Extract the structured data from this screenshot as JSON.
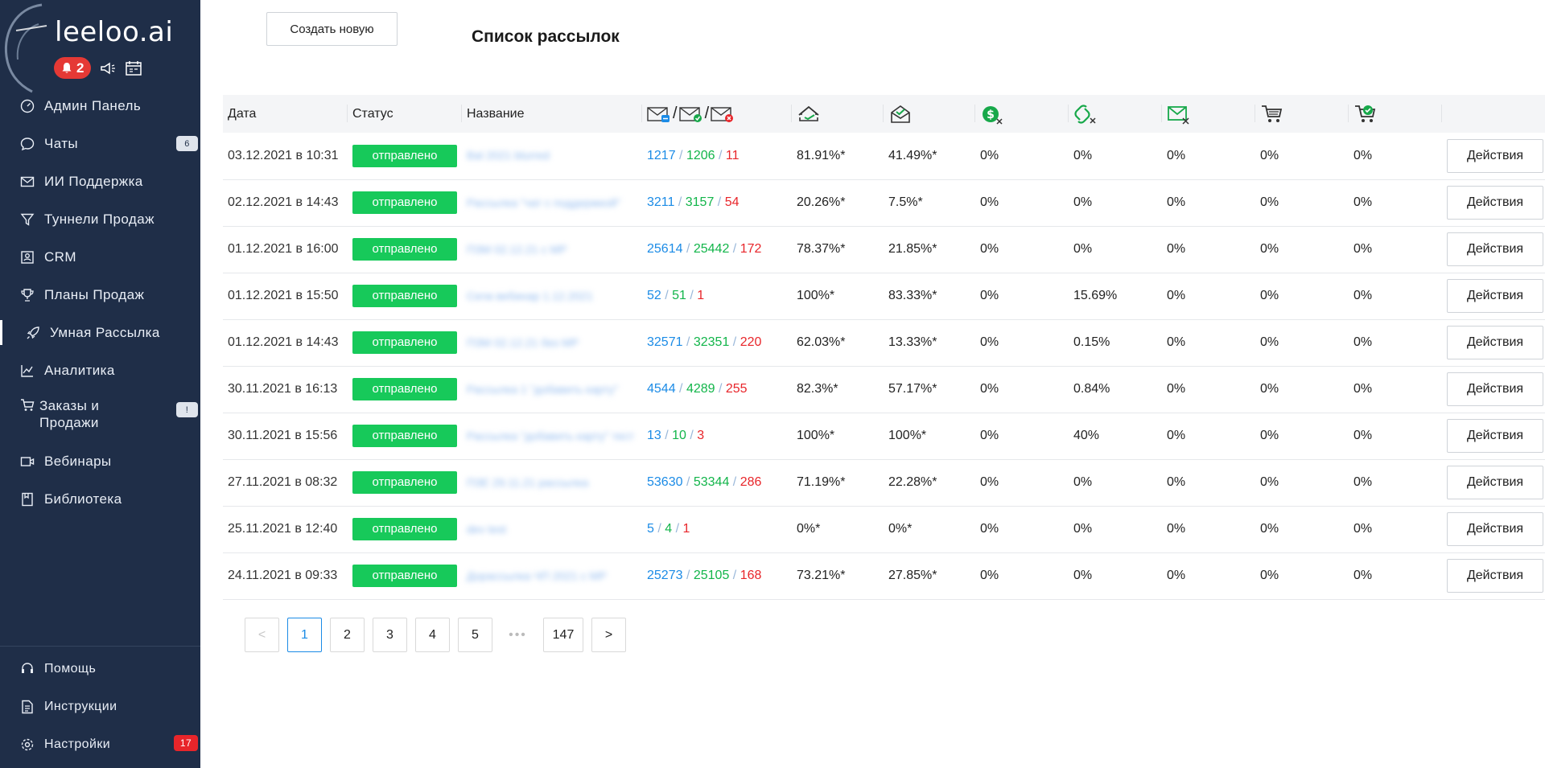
{
  "sidebar": {
    "brand": "leeloo.ai",
    "notifications_count": "2",
    "items": [
      {
        "label": "Админ Панель",
        "icon": "dashboard-icon"
      },
      {
        "label": "Чаты",
        "icon": "chat-icon",
        "badge": "6"
      },
      {
        "label": "ИИ Поддержка",
        "icon": "mail-icon"
      },
      {
        "label": "Туннели Продаж",
        "icon": "funnel-icon"
      },
      {
        "label": "CRM",
        "icon": "crm-icon"
      },
      {
        "label": "Планы Продаж",
        "icon": "trophy-icon"
      },
      {
        "label": "Умная Рассылка",
        "icon": "rocket-icon",
        "active": true
      },
      {
        "label": "Аналитика",
        "icon": "chart-icon"
      },
      {
        "label": "Заказы и\nПродажи",
        "icon": "cart-icon",
        "badge": "!"
      },
      {
        "label": "Вебинары",
        "icon": "video-icon"
      },
      {
        "label": "Библиотека",
        "icon": "book-icon"
      }
    ],
    "bottom_items": [
      {
        "label": "Помощь",
        "icon": "headset-icon"
      },
      {
        "label": "Инструкции",
        "icon": "document-icon"
      },
      {
        "label": "Настройки",
        "icon": "settings-icon",
        "badge": "17"
      }
    ]
  },
  "main": {
    "create_button": "Создать новую",
    "title": "Список рассылок",
    "columns": [
      "Дата",
      "Статус",
      "Название",
      "sent-delivered-failed-icon",
      "opened-icon",
      "read-icon",
      "paid-icon",
      "link-clicks-icon",
      "unsubscribed-icon",
      "cart-icon",
      "cart-purchased-icon"
    ],
    "rows": [
      {
        "date": "03.12.2021 в 10:31",
        "status": "отправлено",
        "name": "Bal 2021 blurred",
        "sent": "1217",
        "delivered": "1206",
        "failed": "11",
        "m1": "81.91%*",
        "m2": "41.49%*",
        "m3": "0%",
        "m4": "0%",
        "m5": "0%",
        "m6": "0%",
        "m7": "0%",
        "action": "Действия"
      },
      {
        "date": "02.12.2021 в 14:43",
        "status": "отправлено",
        "name": "Рассылка \"чат с поддержкой\"",
        "sent": "3211",
        "delivered": "3157",
        "failed": "54",
        "m1": "20.26%*",
        "m2": "7.5%*",
        "m3": "0%",
        "m4": "0%",
        "m5": "0%",
        "m6": "0%",
        "m7": "0%",
        "action": "Действия"
      },
      {
        "date": "01.12.2021 в 16:00",
        "status": "отправлено",
        "name": "ПЗМ 02.12.21 с МР",
        "sent": "25614",
        "delivered": "25442",
        "failed": "172",
        "m1": "78.37%*",
        "m2": "21.85%*",
        "m3": "0%",
        "m4": "0%",
        "m5": "0%",
        "m6": "0%",
        "m7": "0%",
        "action": "Действия"
      },
      {
        "date": "01.12.2021 в 15:50",
        "status": "отправлено",
        "name": "Сегм вебинар 1.12.2021",
        "sent": "52",
        "delivered": "51",
        "failed": "1",
        "m1": "100%*",
        "m2": "83.33%*",
        "m3": "0%",
        "m4": "15.69%",
        "m5": "0%",
        "m6": "0%",
        "m7": "0%",
        "action": "Действия"
      },
      {
        "date": "01.12.2021 в 14:43",
        "status": "отправлено",
        "name": "ПЗМ 02.12.21 без МР",
        "sent": "32571",
        "delivered": "32351",
        "failed": "220",
        "m1": "62.03%*",
        "m2": "13.33%*",
        "m3": "0%",
        "m4": "0.15%",
        "m5": "0%",
        "m6": "0%",
        "m7": "0%",
        "action": "Действия"
      },
      {
        "date": "30.11.2021 в 16:13",
        "status": "отправлено",
        "name": "Рассылка 1 \"добавить карту\"",
        "sent": "4544",
        "delivered": "4289",
        "failed": "255",
        "m1": "82.3%*",
        "m2": "57.17%*",
        "m3": "0%",
        "m4": "0.84%",
        "m5": "0%",
        "m6": "0%",
        "m7": "0%",
        "action": "Действия"
      },
      {
        "date": "30.11.2021 в 15:56",
        "status": "отправлено",
        "name": "Рассылка \"добавить карту\" тест",
        "sent": "13",
        "delivered": "10",
        "failed": "3",
        "m1": "100%*",
        "m2": "100%*",
        "m3": "0%",
        "m4": "40%",
        "m5": "0%",
        "m6": "0%",
        "m7": "0%",
        "action": "Действия"
      },
      {
        "date": "27.11.2021 в 08:32",
        "status": "отправлено",
        "name": "ПЗЕ 29.11.21 рассылка",
        "sent": "53630",
        "delivered": "53344",
        "failed": "286",
        "m1": "71.19%*",
        "m2": "22.28%*",
        "m3": "0%",
        "m4": "0%",
        "m5": "0%",
        "m6": "0%",
        "m7": "0%",
        "action": "Действия"
      },
      {
        "date": "25.11.2021 в 12:40",
        "status": "отправлено",
        "name": "dev test",
        "sent": "5",
        "delivered": "4",
        "failed": "1",
        "m1": "0%*",
        "m2": "0%*",
        "m3": "0%",
        "m4": "0%",
        "m5": "0%",
        "m6": "0%",
        "m7": "0%",
        "action": "Действия"
      },
      {
        "date": "24.11.2021 в 09:33",
        "status": "отправлено",
        "name": "Дорассылка ЧП 2021 с МР",
        "sent": "25273",
        "delivered": "25105",
        "failed": "168",
        "m1": "73.21%*",
        "m2": "27.85%*",
        "m3": "0%",
        "m4": "0%",
        "m5": "0%",
        "m6": "0%",
        "m7": "0%",
        "action": "Действия"
      }
    ],
    "pagination": {
      "prev": "<",
      "pages": [
        "1",
        "2",
        "3",
        "4",
        "5"
      ],
      "dots": "•••",
      "last": "147",
      "next": ">",
      "current": "1"
    }
  },
  "colors": {
    "sidebar_bg": "#1f2e48",
    "status_green": "#17c95a",
    "accent_blue": "#1b8be6",
    "danger_red": "#e8252a",
    "delivered_green": "#12b54a",
    "header_icon_green": "#17a84a"
  }
}
